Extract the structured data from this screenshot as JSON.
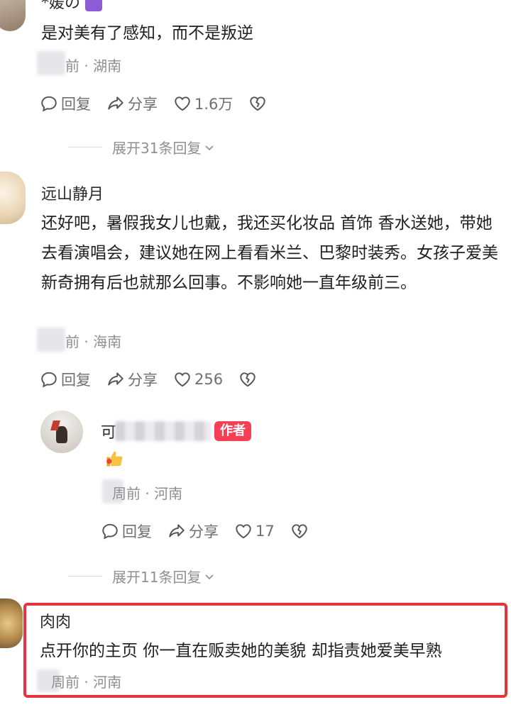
{
  "comments": [
    {
      "username": "*媛の",
      "text": "是对美有了感知，而不是叛逆",
      "time_suffix": "前",
      "location": "· 湖南",
      "actions": {
        "reply": "回复",
        "share": "分享",
        "likes": "1.6万"
      },
      "expand_label": "展开31条回复"
    },
    {
      "username": "远山静月",
      "text": "还好吧，暑假我女儿也戴，我还买化妆品 首饰  香水送她，带她去看演唱会，建议她在网上看看米兰、巴黎时装秀。女孩子爱美新奇拥有后也就那么回事。不影响她一直年级前三。",
      "time_suffix": "前",
      "location": "· 海南",
      "actions": {
        "reply": "回复",
        "share": "分享",
        "likes": "256"
      }
    },
    {
      "username_initial": "可",
      "badge": "作者",
      "time_suffix": "周前",
      "location": "· 河南",
      "actions": {
        "reply": "回复",
        "share": "分享",
        "likes": "17"
      },
      "expand_label": "展开11条回复"
    },
    {
      "username": "肉肉",
      "text": "点开你的主页 你一直在贩卖她的美貌 却指责她爱美早熟",
      "time_suffix": "周前",
      "location": "· 河南"
    }
  ],
  "colors": {
    "accent": "#f53f55",
    "highlight": "#e8323c",
    "meta": "#8e8e93"
  }
}
